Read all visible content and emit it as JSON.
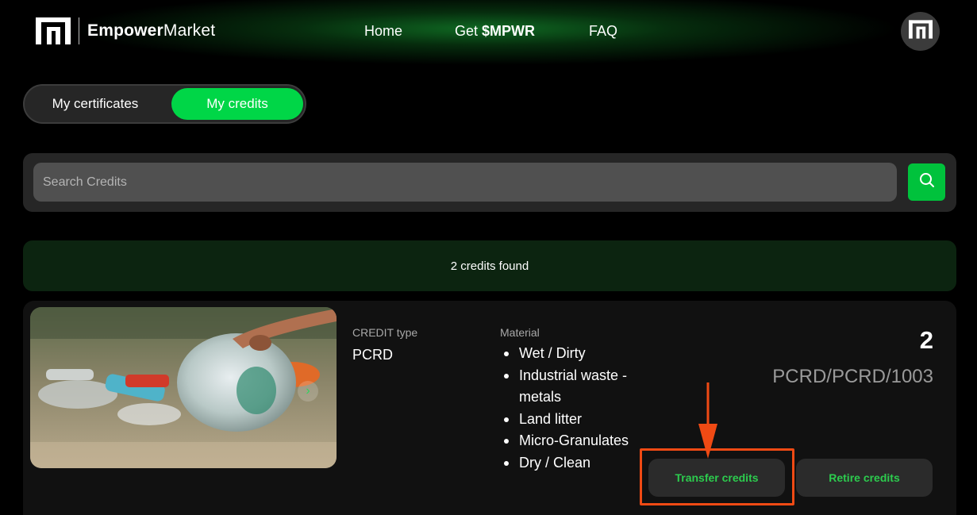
{
  "brand": {
    "name_bold": "Empower",
    "name_rest": "Market",
    "logo_icon": "empower-logo-icon"
  },
  "nav": {
    "home": "Home",
    "get_prefix": "Get ",
    "get_token": "$MPWR",
    "faq": "FAQ"
  },
  "avatar": {
    "icon": "empower-avatar-icon"
  },
  "tabs": {
    "certificates": "My certificates",
    "credits": "My credits",
    "active": "credits"
  },
  "search": {
    "placeholder": "Search Credits",
    "value": "",
    "button_icon": "search-icon"
  },
  "results": {
    "found_text": "2 credits found"
  },
  "credit_card": {
    "credit_type_label": "CREDIT type",
    "credit_type": "PCRD",
    "material_label": "Material",
    "materials": [
      "Wet / Dirty",
      "Industrial waste - metals",
      "Land litter",
      "Micro-Granulates",
      "Dry / Clean"
    ],
    "count": "2",
    "serial": "PCRD/PCRD/1003",
    "transfer_button": "Transfer credits",
    "retire_button": "Retire credits",
    "image_next_icon": "chevron-right-icon"
  },
  "annotation": {
    "highlight_color": "#f04a14",
    "arrow_icon": "down-arrow-icon"
  },
  "colors": {
    "accent": "#00d647",
    "button_text": "#2ccc4e",
    "found_bg": "#0c2410"
  }
}
